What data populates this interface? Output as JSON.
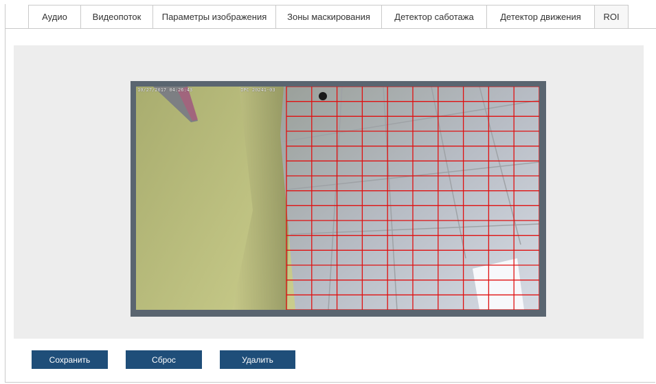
{
  "tabs": [
    {
      "label": "Аудио"
    },
    {
      "label": "Видеопоток"
    },
    {
      "label": "Параметры изображения"
    },
    {
      "label": "Зоны маскирования"
    },
    {
      "label": "Детектор саботажа"
    },
    {
      "label": "Детектор движения"
    },
    {
      "label": "ROI"
    }
  ],
  "active_tab": "ROI",
  "video": {
    "osd_datetime": "10/27/2017 04:26:43",
    "osd_camera": "IPC 20241-03"
  },
  "roi_grid": {
    "color": "#e01010",
    "columns": 10,
    "rows": 15
  },
  "buttons": {
    "save_label": "Сохранить",
    "reset_label": "Сброс",
    "delete_label": "Удалить"
  },
  "colors": {
    "button_bg": "#1f4e79",
    "viewer_frame": "#5a6570",
    "stage_bg": "#ededed"
  }
}
